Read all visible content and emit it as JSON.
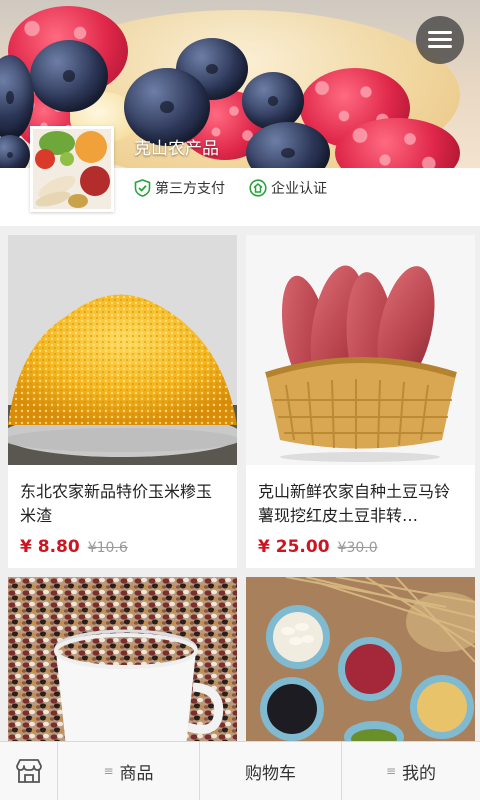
{
  "header": {
    "store_name": "克山农产品",
    "menu_icon": "hamburger-menu-icon"
  },
  "store": {
    "badges": [
      {
        "icon": "shield-check-icon",
        "label": "第三方支付"
      },
      {
        "icon": "enterprise-cert-icon",
        "label": "企业认证"
      }
    ]
  },
  "products": [
    {
      "title": "东北农家新品特价玉米糁玉米渣",
      "price": "¥ 8.80",
      "original_price": "¥10.6"
    },
    {
      "title": "克山新鲜农家自种土豆马铃薯现挖红皮土豆非转…",
      "price": "¥ 25.00",
      "original_price": "¥30.0"
    },
    {
      "title": "",
      "price": "",
      "original_price": ""
    },
    {
      "title": "",
      "price": "",
      "original_price": ""
    }
  ],
  "bottom_nav": {
    "shop_icon": "storefront-icon",
    "items": [
      {
        "label": "商品",
        "icon": "list-icon"
      },
      {
        "label": "购物车"
      },
      {
        "label": "我的",
        "icon": "list-icon"
      }
    ]
  },
  "colors": {
    "price_red": "#d0141f",
    "badge_green": "#2aa33d",
    "background": "#efefef"
  }
}
